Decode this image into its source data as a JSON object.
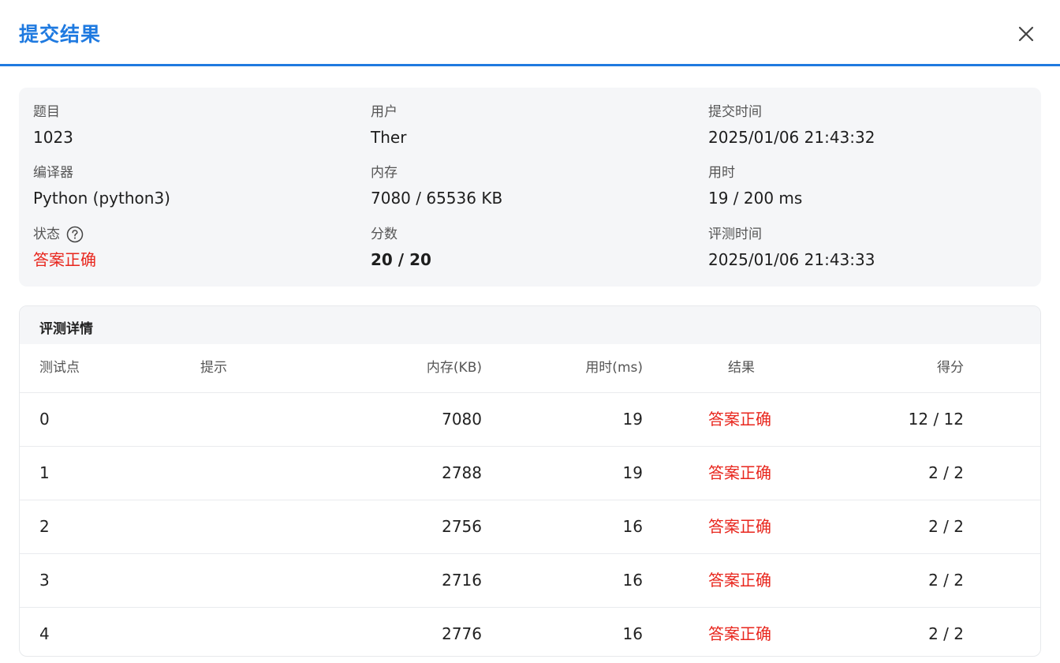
{
  "dialog": {
    "title": "提交结果"
  },
  "info": {
    "problem_label": "题目",
    "problem_value": "1023",
    "user_label": "用户",
    "user_value": "Ther",
    "submit_time_label": "提交时间",
    "submit_time_value": "2025/01/06 21:43:32",
    "compiler_label": "编译器",
    "compiler_value": "Python (python3)",
    "memory_label": "内存",
    "memory_value": "7080 / 65536 KB",
    "time_label": "用时",
    "time_value": "19 / 200 ms",
    "status_label": "状态",
    "status_value": "答案正确",
    "score_label": "分数",
    "score_value": "20 / 20",
    "judge_time_label": "评测时间",
    "judge_time_value": "2025/01/06 21:43:33"
  },
  "details": {
    "title": "评测详情",
    "columns": [
      "测试点",
      "提示",
      "内存(KB)",
      "用时(ms)",
      "结果",
      "得分"
    ],
    "rows": [
      {
        "case": "0",
        "hint": "",
        "memory": "7080",
        "time": "19",
        "result": "答案正确",
        "score": "12 / 12"
      },
      {
        "case": "1",
        "hint": "",
        "memory": "2788",
        "time": "19",
        "result": "答案正确",
        "score": "2 / 2"
      },
      {
        "case": "2",
        "hint": "",
        "memory": "2756",
        "time": "16",
        "result": "答案正确",
        "score": "2 / 2"
      },
      {
        "case": "3",
        "hint": "",
        "memory": "2716",
        "time": "16",
        "result": "答案正确",
        "score": "2 / 2"
      },
      {
        "case": "4",
        "hint": "",
        "memory": "2776",
        "time": "16",
        "result": "答案正确",
        "score": "2 / 2"
      }
    ]
  },
  "colors": {
    "accent": "#1f7ae0",
    "success_text": "#e8261d",
    "panel_bg": "#f5f6f8"
  },
  "icons": {
    "close": "close-icon",
    "help": "help-circle-icon"
  }
}
